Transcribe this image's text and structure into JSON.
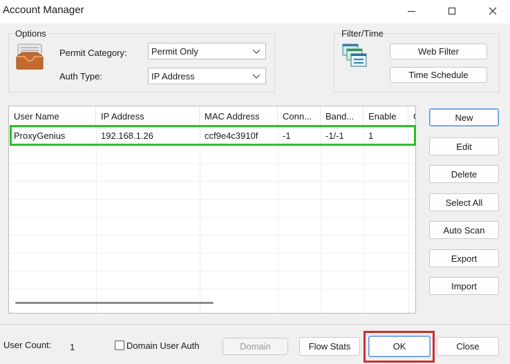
{
  "window": {
    "title": "Account Manager"
  },
  "options": {
    "label": "Options",
    "permit_category_label": "Permit Category:",
    "permit_category_value": "Permit Only",
    "auth_type_label": "Auth Type:",
    "auth_type_value": "IP Address"
  },
  "filter_time": {
    "label": "Filter/Time",
    "web_filter_label": "Web Filter",
    "time_schedule_label": "Time Schedule"
  },
  "table": {
    "columns": [
      "User Name",
      "IP Address",
      "MAC Address",
      "Conn...",
      "Band...",
      "Enable",
      "G"
    ],
    "rows": [
      [
        "ProxyGenius",
        "192.168.1.26",
        "ccf9e4c3910f",
        "-1",
        "-1/-1",
        "1",
        "("
      ]
    ]
  },
  "side_buttons": {
    "new": "New",
    "edit": "Edit",
    "delete": "Delete",
    "select_all": "Select All",
    "auto_scan": "Auto Scan",
    "export": "Export",
    "import": "Import"
  },
  "footer": {
    "user_count_label": "User Count:",
    "user_count_value": "1",
    "domain_user_auth_label": "Domain User Auth",
    "domain_label": "Domain",
    "flow_stats_label": "Flow Stats",
    "ok_label": "OK",
    "close_label": "Close"
  },
  "colors": {
    "highlight_green": "#27c227",
    "highlight_red": "#d22b2b",
    "accent_blue": "#5b8fd6"
  }
}
